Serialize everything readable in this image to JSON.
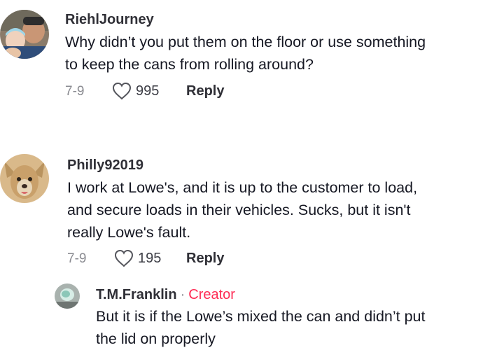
{
  "comments": [
    {
      "username": "RiehlJourney",
      "text_lines": [
        "Why didn’t you put them on the floor or use something",
        "to keep the cans from rolling around?"
      ],
      "date": "7-9",
      "likes": "995",
      "reply_label": "Reply"
    },
    {
      "username": "Philly92019",
      "text_lines": [
        "I work at Lowe's, and it is up to the customer to load,",
        "and secure loads in their vehicles. Sucks, but it isn't",
        "really Lowe's fault."
      ],
      "date": "7-9",
      "likes": "195",
      "reply_label": "Reply"
    }
  ],
  "reply": {
    "username": "T.M.Franklin",
    "separator": "·",
    "badge": "Creator",
    "text_lines": [
      "But it is if the Lowe’s mixed the can and didn’t put",
      "the lid on properly"
    ]
  },
  "icons": {
    "like": "heart-outline-icon"
  },
  "colors": {
    "text": "#161823",
    "secondary": "#8a8b91",
    "creator": "#fe2c55"
  }
}
